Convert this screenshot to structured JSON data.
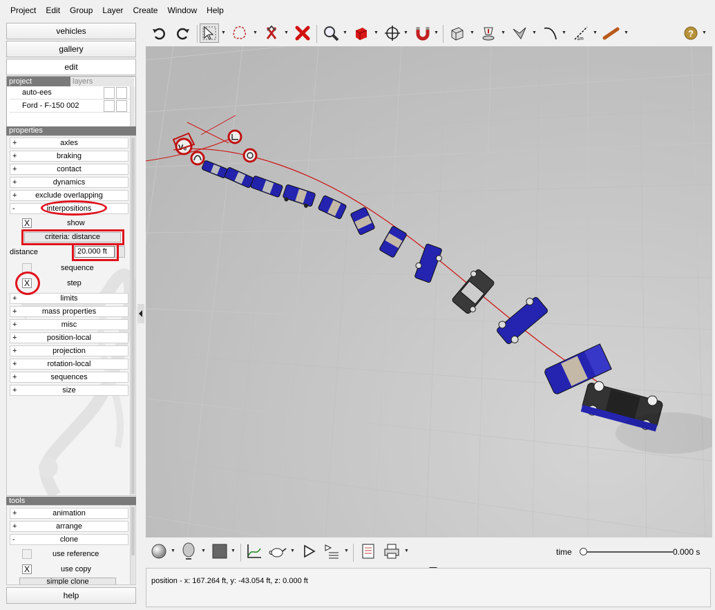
{
  "menubar": [
    "Project",
    "Edit",
    "Group",
    "Layer",
    "Create",
    "Window",
    "Help"
  ],
  "left_nav": {
    "vehicles": "vehicles",
    "gallery": "gallery",
    "edit": "edit",
    "help": "help"
  },
  "project_panel": {
    "tabs": [
      "project",
      "layers"
    ],
    "items": [
      "auto-ees",
      "Ford - F-150 002"
    ]
  },
  "properties": {
    "header": "properties",
    "rows_before": [
      {
        "sign": "+",
        "label": "axles"
      },
      {
        "sign": "+",
        "label": "braking"
      },
      {
        "sign": "+",
        "label": "contact"
      },
      {
        "sign": "+",
        "label": "dynamics"
      },
      {
        "sign": "+",
        "label": "exclude overlapping"
      },
      {
        "sign": "-",
        "label": "interpositions"
      }
    ],
    "interpositions": {
      "show_label": "show",
      "show_checked": "X",
      "criteria_label": "criteria: distance",
      "distance_label": "distance",
      "distance_value": "20.000 ft",
      "sequence_label": "sequence",
      "step_label": "step",
      "step_checked": "X"
    },
    "rows_after": [
      {
        "sign": "+",
        "label": "limits"
      },
      {
        "sign": "+",
        "label": "mass properties"
      },
      {
        "sign": "+",
        "label": "misc"
      },
      {
        "sign": "+",
        "label": "position-local"
      },
      {
        "sign": "+",
        "label": "projection"
      },
      {
        "sign": "+",
        "label": "rotation-local"
      },
      {
        "sign": "+",
        "label": "sequences"
      },
      {
        "sign": "+",
        "label": "size"
      }
    ]
  },
  "tools": {
    "header": "tools",
    "rows": [
      {
        "sign": "+",
        "label": "animation"
      },
      {
        "sign": "+",
        "label": "arrange"
      },
      {
        "sign": "-",
        "label": "clone"
      }
    ],
    "use_reference_label": "use reference",
    "use_copy_label": "use copy",
    "use_copy_checked": "X",
    "partial_button": "simple clone"
  },
  "top_toolbar_icons": [
    "undo-icon",
    "redo-icon",
    "select-arrow-icon",
    "lasso-icon",
    "no-collision-icon",
    "delete-icon",
    "zoom-icon",
    "red-cube-icon",
    "move-crosshair-icon",
    "magnet-icon",
    "box-view-icon",
    "camera-target-icon",
    "surface-plane-icon",
    "path-curve-icon",
    "measure-ruler-icon",
    "tape-tool-icon",
    "help-icon"
  ],
  "bottom_toolbar": {
    "icons": [
      "sphere-icon",
      "head-icon",
      "color-swatch-icon",
      "graph-icon",
      "teapot-icon",
      "play-icon",
      "render-list-icon",
      "report-icon",
      "print-icon"
    ],
    "time_label": "time",
    "time_value": "0.000 s",
    "time_position": 0
  },
  "status": {
    "position": "position - x: 167.264 ft, y: -43.054 ft, z: 0.000 ft"
  },
  "viewport": {
    "markers": [
      "V₀"
    ],
    "colors": {
      "vehicle": "#2222aa",
      "path": "#d01010",
      "highlight": "#e0101b",
      "ground": "#cdcdcd"
    }
  }
}
